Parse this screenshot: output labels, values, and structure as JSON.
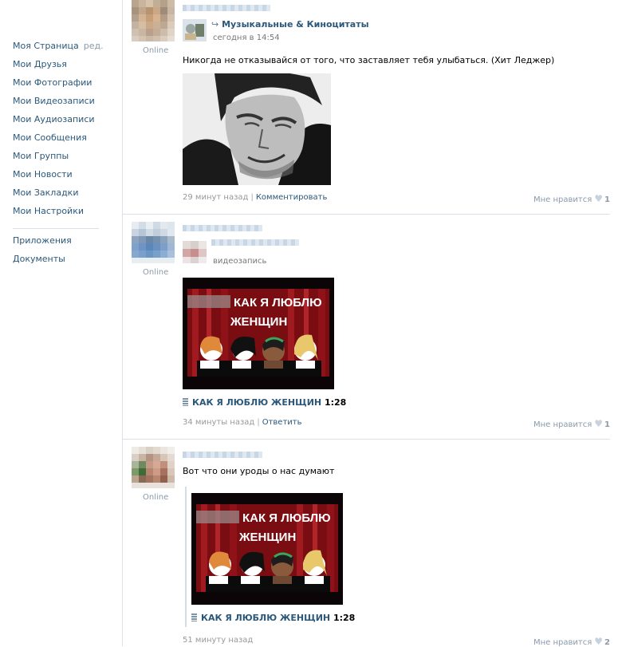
{
  "menu": {
    "items": [
      {
        "label": "Моя Страница",
        "extra": "ред."
      },
      {
        "label": "Мои Друзья"
      },
      {
        "label": "Мои Фотографии"
      },
      {
        "label": "Мои Видеозаписи"
      },
      {
        "label": "Мои Аудиозаписи"
      },
      {
        "label": "Мои Сообщения"
      },
      {
        "label": "Мои Группы"
      },
      {
        "label": "Мои Новости"
      },
      {
        "label": "Мои Закладки"
      },
      {
        "label": "Мои Настройки"
      }
    ],
    "extra_items": [
      {
        "label": "Приложения"
      },
      {
        "label": "Документы"
      }
    ]
  },
  "posts": [
    {
      "online": "Online",
      "repost_group": "Музыкальные & Киноцитаты",
      "repost_date": "сегодня в 14:54",
      "text": "Никогда не отказывайся от того, что заставляет тебя улыбаться. (Хит Леджер)",
      "time": "29 минут назад",
      "action": "Комментировать",
      "like_label": "Мне нравится",
      "like_count": "1"
    },
    {
      "online": "Online",
      "shared_type": "видеозапись",
      "video_overlay": [
        "КАК Я ЛЮБЛЮ",
        "ЖЕНЩИН"
      ],
      "video_title": "КАК Я ЛЮБЛЮ ЖЕНЩИН",
      "video_duration": "1:28",
      "time": "34 минуты назад",
      "action": "Ответить",
      "like_label": "Мне нравится",
      "like_count": "1"
    },
    {
      "online": "Online",
      "text": "Вот что они уроды о нас думают",
      "video_overlay": [
        "КАК Я ЛЮБЛЮ",
        "ЖЕНЩИН"
      ],
      "video_title": "КАК Я ЛЮБЛЮ ЖЕНЩИН",
      "video_duration": "1:28",
      "time": "51 минуту назад",
      "like_label": "Мне нравится",
      "like_count": "2"
    }
  ],
  "colors": {
    "link": "#2B587A",
    "divider": "#DAE1E8",
    "muted": "#8a9aaa"
  }
}
